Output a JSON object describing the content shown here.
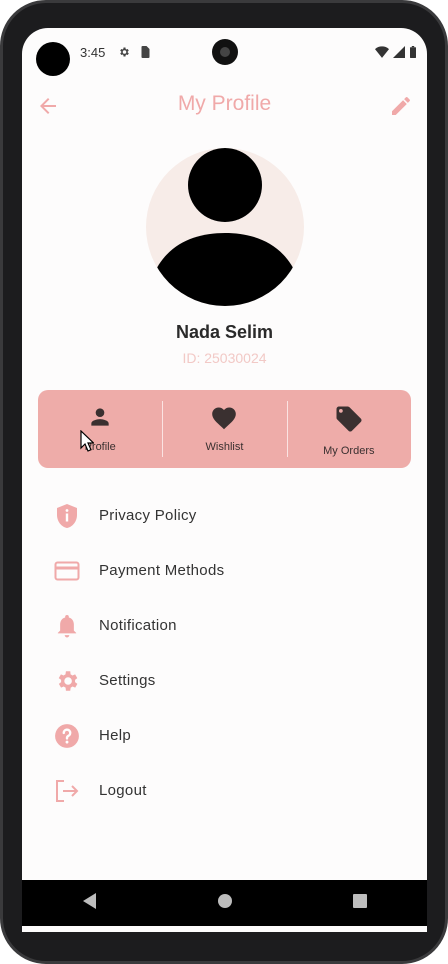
{
  "status_bar": {
    "time": "3:45"
  },
  "app_bar": {
    "title": "My Profile"
  },
  "profile": {
    "name": "Nada Selim",
    "id_text": "ID: 25030024"
  },
  "actions": [
    {
      "label": "Profile",
      "icon": "person-icon"
    },
    {
      "label": "Wishlist",
      "icon": "heart-icon"
    },
    {
      "label": "My Orders",
      "icon": "tag-icon"
    }
  ],
  "menu": [
    {
      "label": "Privacy Policy",
      "icon": "shield-info-icon"
    },
    {
      "label": "Payment Methods",
      "icon": "credit-card-icon"
    },
    {
      "label": "Notification",
      "icon": "bell-icon"
    },
    {
      "label": "Settings",
      "icon": "gear-icon"
    },
    {
      "label": "Help",
      "icon": "help-icon"
    },
    {
      "label": "Logout",
      "icon": "logout-icon"
    }
  ],
  "colors": {
    "accent": "#f0a9a9",
    "card": "#eeaca9",
    "icon_dark": "#3a3030"
  }
}
